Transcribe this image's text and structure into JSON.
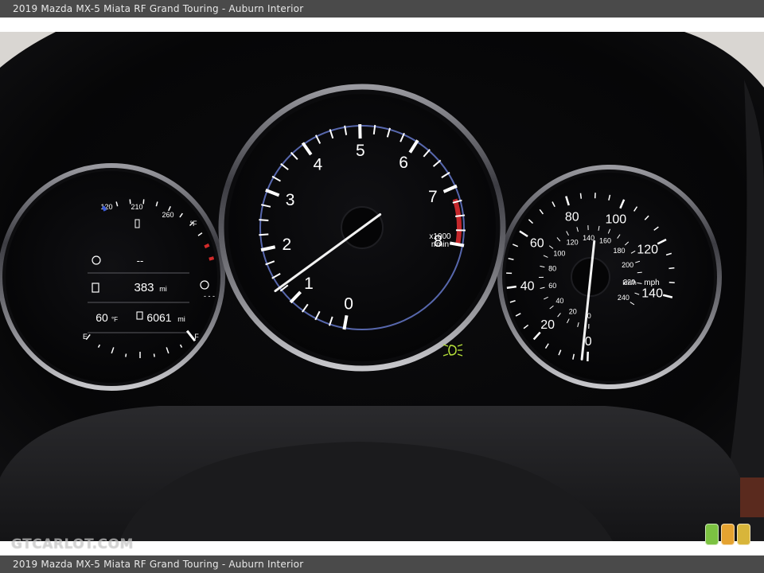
{
  "caption": {
    "top": "2019 Mazda MX-5 Miata RF Grand Touring - Auburn Interior",
    "bottom": "2019 Mazda MX-5 Miata RF Grand Touring - Auburn Interior"
  },
  "watermark": "GTCARLOT.COM",
  "badge_colors": [
    "#7cc242",
    "#e5a331",
    "#d8b53a"
  ],
  "tachometer": {
    "labels": [
      "0",
      "1",
      "2",
      "3",
      "4",
      "5",
      "6",
      "7",
      "8"
    ],
    "unit_line1": "x1000",
    "unit_line2": "r/min",
    "needle_value": 1.3
  },
  "speedometer": {
    "mph_labels": [
      "0",
      "20",
      "40",
      "60",
      "80",
      "100",
      "120",
      "140"
    ],
    "kmh_labels": [
      "0",
      "20",
      "40",
      "60",
      "80",
      "100",
      "120",
      "140",
      "160",
      "180",
      "200",
      "220",
      "240"
    ],
    "unit_kmh": "km/h",
    "unit_mph": "mph",
    "needle_value": 2
  },
  "info_gauge": {
    "temp_labels": [
      "120",
      "210",
      "260"
    ],
    "temp_unit": "°F",
    "line1": "--",
    "range_value": "383",
    "range_unit": "mi",
    "trip_placeholder": "- - -",
    "outside_temp": "60",
    "outside_temp_unit": "°F",
    "odometer_value": "6061",
    "odometer_unit": "mi",
    "fuel_empty": "E",
    "fuel_full": "F"
  }
}
